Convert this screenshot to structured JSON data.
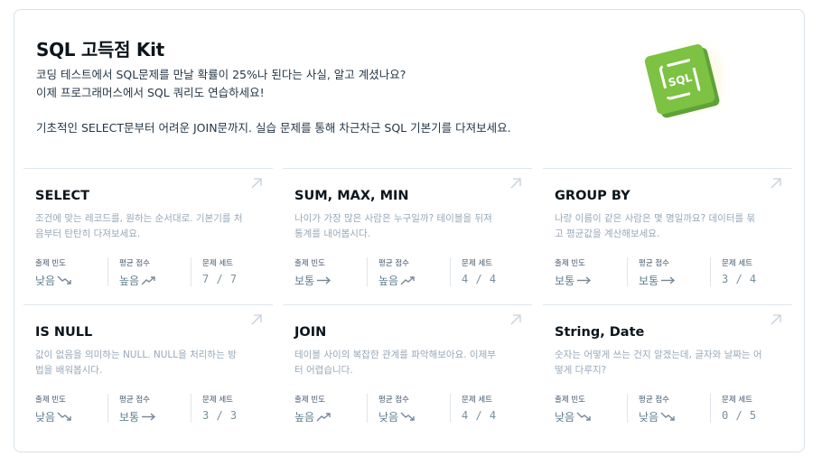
{
  "kit": {
    "title": "SQL 고득점 Kit",
    "desc_line1": "코딩 테스트에서 SQL문제를 만날 확률이 25%나 된다는 사실, 알고 계셨나요?",
    "desc_line2": "이제 프로그래머스에서 SQL 쿼리도 연습하세요!",
    "desc_line3": "기초적인 SELECT문부터 어려운 JOIN문까지. 실습 문제를 통해 차근차근 SQL 기본기를 다져보세요.",
    "logo_text": "SQL"
  },
  "stat_labels": {
    "frequency": "출제 빈도",
    "avg_score": "평균 점수",
    "problem_set": "문제 세트"
  },
  "icons": {
    "trend_up": "trend-up-icon",
    "trend_down": "trend-down-icon",
    "trend_flat": "trend-flat-icon",
    "open_link": "arrow-up-right-icon"
  },
  "colors": {
    "logo_green": "#7dc242",
    "logo_green_dark": "#4f9a2a"
  },
  "topics": [
    {
      "name": "SELECT",
      "desc": "조건에 맞는 레코드를, 원하는 순서대로. 기본기를 처음부터 탄탄히 다져보세요.",
      "frequency": "낮음",
      "frequency_trend": "down",
      "avg_score": "높음",
      "avg_score_trend": "up",
      "problem_set": "7 / 7"
    },
    {
      "name": "SUM, MAX, MIN",
      "desc": "나이가 가장 많은 사람은 누구일까? 테이블을 뒤져 통계를 내어봅시다.",
      "frequency": "보통",
      "frequency_trend": "flat",
      "avg_score": "높음",
      "avg_score_trend": "up",
      "problem_set": "4 / 4"
    },
    {
      "name": "GROUP BY",
      "desc": "나랑 이름이 같은 사람은 몇 명일까요? 데이터를 묶고 평균값을 계산해보세요.",
      "frequency": "보통",
      "frequency_trend": "flat",
      "avg_score": "보통",
      "avg_score_trend": "flat",
      "problem_set": "3 / 4"
    },
    {
      "name": "IS NULL",
      "desc": "값이 없음을 의미하는 NULL. NULL을 처리하는 방법을 배워봅시다.",
      "frequency": "낮음",
      "frequency_trend": "down",
      "avg_score": "보통",
      "avg_score_trend": "flat",
      "problem_set": "3 / 3"
    },
    {
      "name": "JOIN",
      "desc": "테이블 사이의 복잡한 관계를 파악해보아요. 이제부터 어렵습니다.",
      "frequency": "높음",
      "frequency_trend": "up",
      "avg_score": "낮음",
      "avg_score_trend": "down",
      "problem_set": "4 / 4"
    },
    {
      "name": "String, Date",
      "desc": "숫자는 어떻게 쓰는 건지 알겠는데, 글자와 날짜는 어떻게 다루지?",
      "frequency": "낮음",
      "frequency_trend": "down",
      "avg_score": "낮음",
      "avg_score_trend": "down",
      "problem_set": "0 / 5"
    }
  ]
}
